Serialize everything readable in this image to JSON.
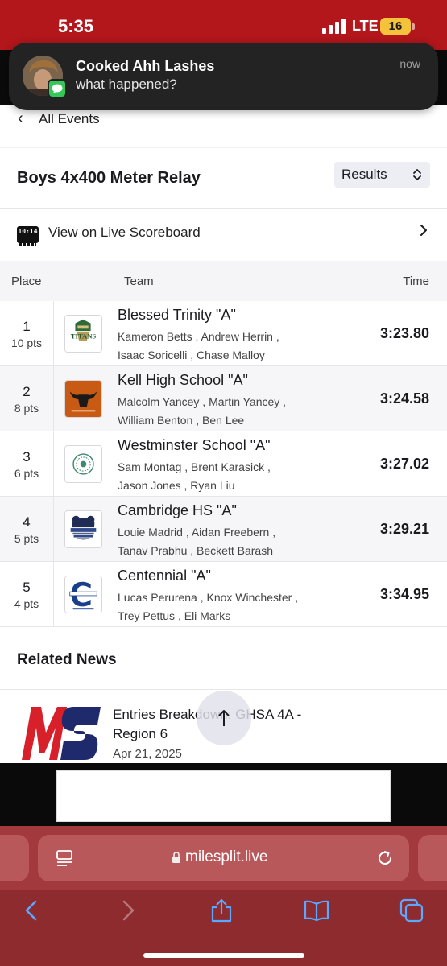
{
  "status_bar": {
    "time": "5:35",
    "network": "LTE",
    "battery": "16"
  },
  "notification": {
    "sender": "Cooked Ahh Lashes",
    "message": "what happened?",
    "time": "now",
    "app_icon": "messages-icon"
  },
  "nav": {
    "back_label": "All Events"
  },
  "event": {
    "title": "Boys 4x400 Meter Relay",
    "view_selector": {
      "selected": "Results"
    },
    "live_scoreboard_label": "View on Live Scoreboard",
    "live_icon_text": "10:14"
  },
  "table": {
    "headers": {
      "place": "Place",
      "team": "Team",
      "time": "Time"
    },
    "rows": [
      {
        "place": "1",
        "points": "10 pts",
        "team": "Blessed Trinity \"A\"",
        "athletes_line1": "Kameron Betts , Andrew Herrin ,",
        "athletes_line2": "Isaac Soricelli , Chase Malloy",
        "time": "3:23.80",
        "logo": "titans-logo"
      },
      {
        "place": "2",
        "points": "8 pts",
        "team": "Kell High School \"A\"",
        "athletes_line1": "Malcolm Yancey , Martin Yancey ,",
        "athletes_line2": "William Benton , Ben Lee",
        "time": "3:24.58",
        "logo": "longhorn-logo"
      },
      {
        "place": "3",
        "points": "6 pts",
        "team": "Westminster School \"A\"",
        "athletes_line1": "Sam Montag , Brent Karasick ,",
        "athletes_line2": "Jason Jones , Ryan Liu",
        "time": "3:27.02",
        "logo": "westminster-seal-logo"
      },
      {
        "place": "4",
        "points": "5 pts",
        "team": "Cambridge HS \"A\"",
        "athletes_line1": "Louie Madrid , Aidan Freebern ,",
        "athletes_line2": "Tanav Prabhu , Beckett Barash",
        "time": "3:29.21",
        "logo": "cambridge-bears-logo"
      },
      {
        "place": "5",
        "points": "4 pts",
        "team": "Centennial \"A\"",
        "athletes_line1": "Lucas Perurena , Knox Winchester ,",
        "athletes_line2": "Trey Pettus , Eli Marks",
        "time": "3:34.95",
        "logo": "centennial-logo"
      }
    ]
  },
  "related_news": {
    "heading": "Related News",
    "items": [
      {
        "title": "Entries Breakdown: GHSA 4A - Region 6",
        "date": "Apr 21, 2025",
        "logo": "milesplit-logo"
      }
    ]
  },
  "browser": {
    "url": "milesplit.live"
  },
  "colors": {
    "brand_red": "#b3161b",
    "safari_bar": "#a23a3d",
    "news_logo_red": "#d8202a",
    "news_logo_navy": "#1e2a6b"
  }
}
